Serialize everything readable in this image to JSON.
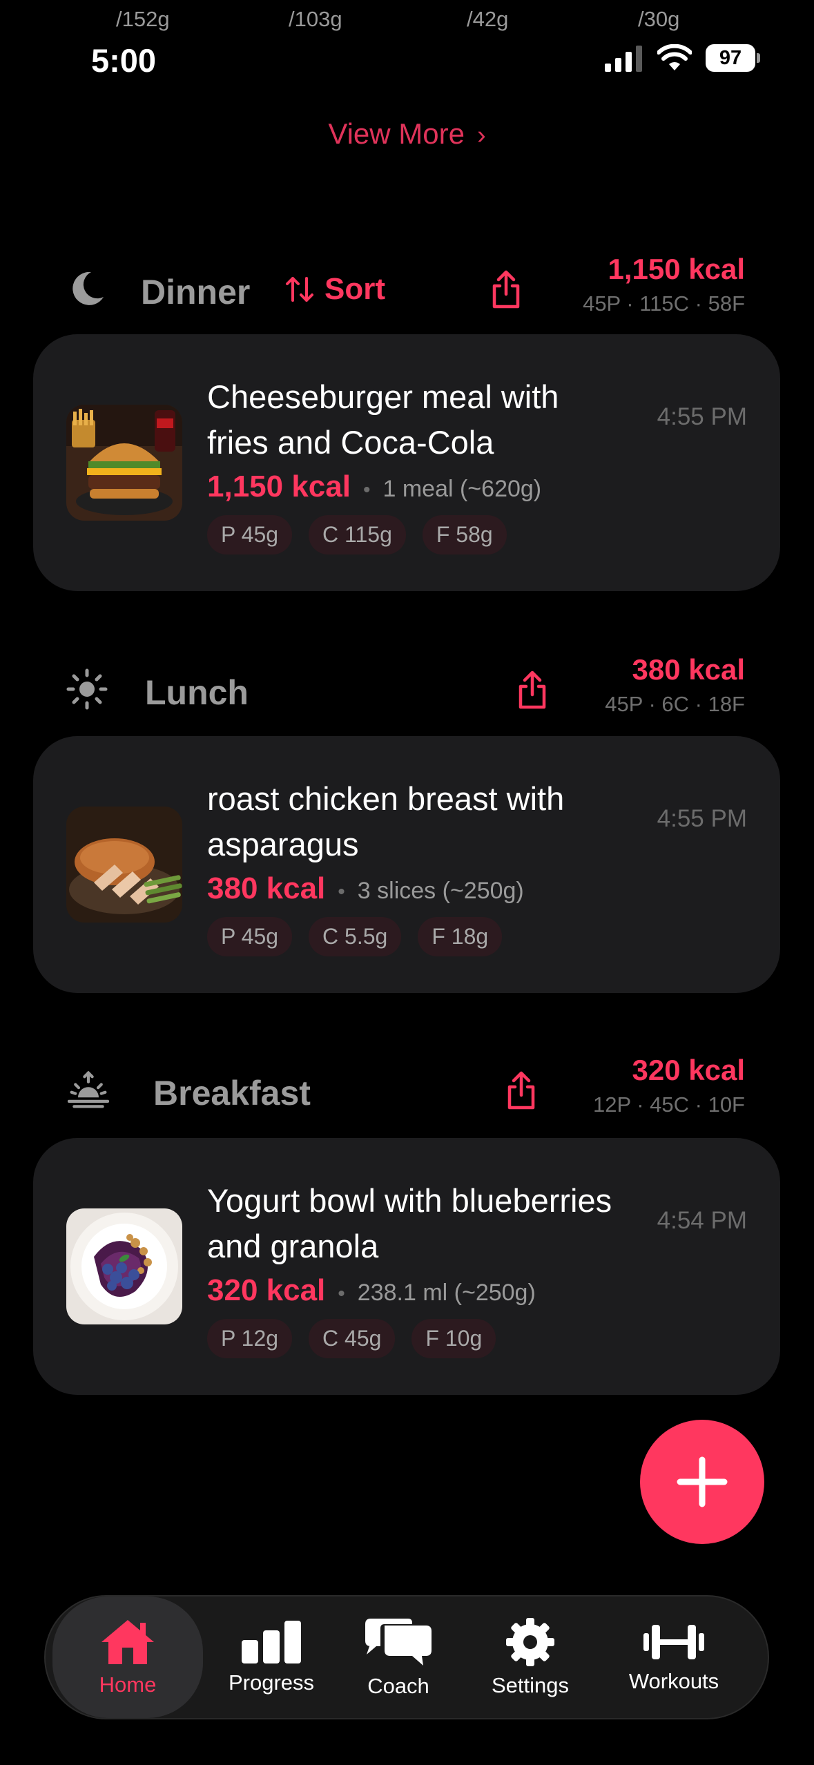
{
  "top_remnants": [
    "/152g",
    "/103g",
    "/42g",
    "/30g"
  ],
  "status_bar": {
    "time": "5:00",
    "battery": "97"
  },
  "view_more": {
    "label": "View More"
  },
  "sections": {
    "dinner": {
      "title": "Dinner",
      "sort_label": "Sort",
      "kcal": "1,150 kcal",
      "macros": "45P · 115C · 58F",
      "meal": {
        "name": "Cheeseburger meal with fries and Coca-Cola",
        "time": "4:55 PM",
        "kcal": "1,150 kcal",
        "portion": "1 meal (~620g)",
        "chips": [
          "P 45g",
          "C 115g",
          "F 58g"
        ]
      }
    },
    "lunch": {
      "title": "Lunch",
      "kcal": "380 kcal",
      "macros": "45P · 6C · 18F",
      "meal": {
        "name": "roast chicken breast with asparagus",
        "time": "4:55 PM",
        "kcal": "380 kcal",
        "portion": "3 slices (~250g)",
        "chips": [
          "P 45g",
          "C 5.5g",
          "F 18g"
        ]
      }
    },
    "breakfast": {
      "title": "Breakfast",
      "kcal": "320 kcal",
      "macros": "12P · 45C · 10F",
      "meal": {
        "name": "Yogurt bowl with blueberries and granola",
        "time": "4:54 PM",
        "kcal": "320 kcal",
        "portion": "238.1 ml (~250g)",
        "chips": [
          "P 12g",
          "C 45g",
          "F 10g"
        ]
      }
    }
  },
  "tabs": [
    {
      "label": "Home",
      "icon": "home-icon",
      "active": true
    },
    {
      "label": "Progress",
      "icon": "bar-chart-icon",
      "active": false
    },
    {
      "label": "Coach",
      "icon": "chat-bubbles-icon",
      "active": false
    },
    {
      "label": "Settings",
      "icon": "gear-icon",
      "active": false
    },
    {
      "label": "Workouts",
      "icon": "dumbbell-icon",
      "active": false
    }
  ],
  "colors": {
    "accent": "#ff375f",
    "card": "#1c1c1e",
    "background": "#000000"
  }
}
